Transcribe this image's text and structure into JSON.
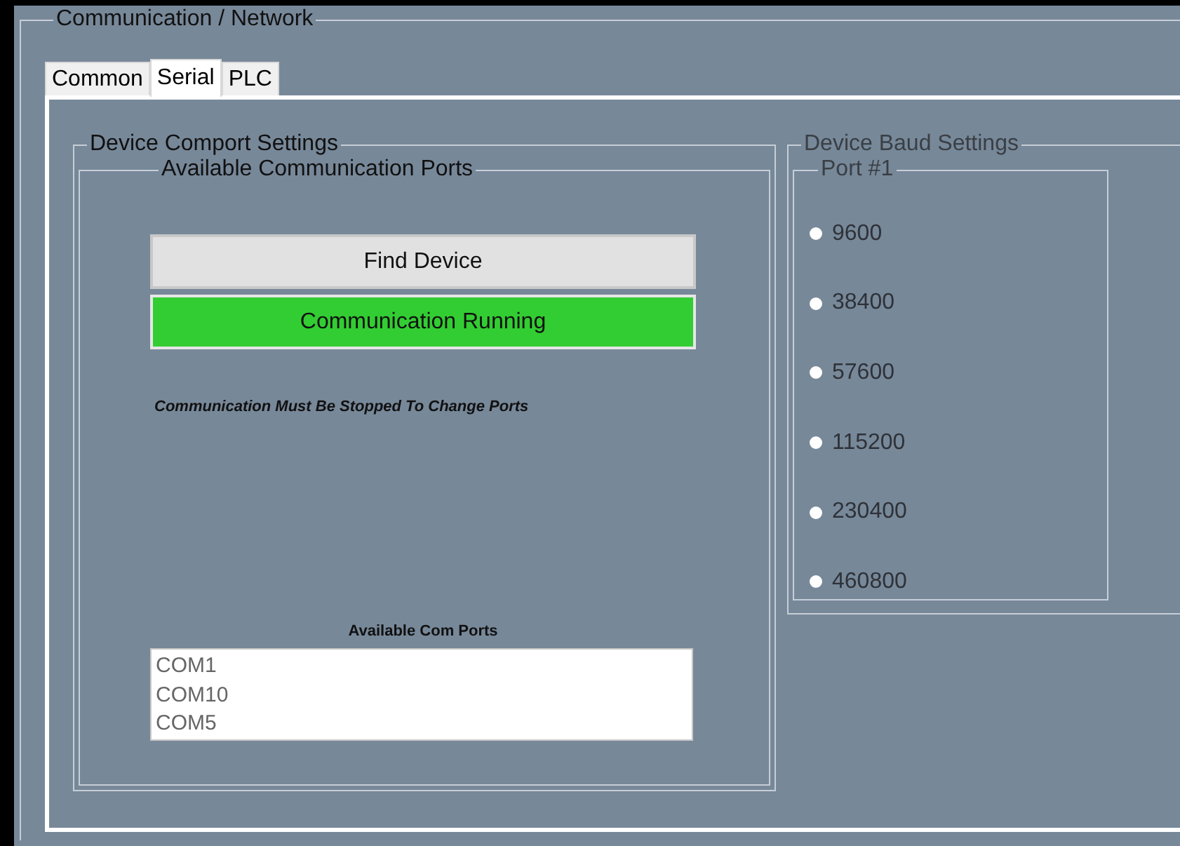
{
  "group": {
    "title": "Communication / Network"
  },
  "tabs": [
    {
      "label": "Common",
      "selected": false
    },
    {
      "label": "Serial",
      "selected": true
    },
    {
      "label": "PLC",
      "selected": false
    }
  ],
  "comport": {
    "title": "Device Comport Settings",
    "ports_group": {
      "title": "Available Communication Ports"
    },
    "find_button": "Find Device",
    "status_button": {
      "label": "Communication Running",
      "running": true
    },
    "note": "Communication Must Be Stopped To Change Ports",
    "list_label": "Available Com Ports",
    "ports": [
      "COM1",
      "COM10",
      "COM5"
    ]
  },
  "baud": {
    "title": "Device Baud Settings",
    "port_title": "Port #1",
    "options": [
      {
        "label": "9600",
        "selected": false
      },
      {
        "label": "38400",
        "selected": false
      },
      {
        "label": "57600",
        "selected": false
      },
      {
        "label": "115200",
        "selected": false
      },
      {
        "label": "230400",
        "selected": false
      },
      {
        "label": "460800",
        "selected": false
      }
    ]
  }
}
